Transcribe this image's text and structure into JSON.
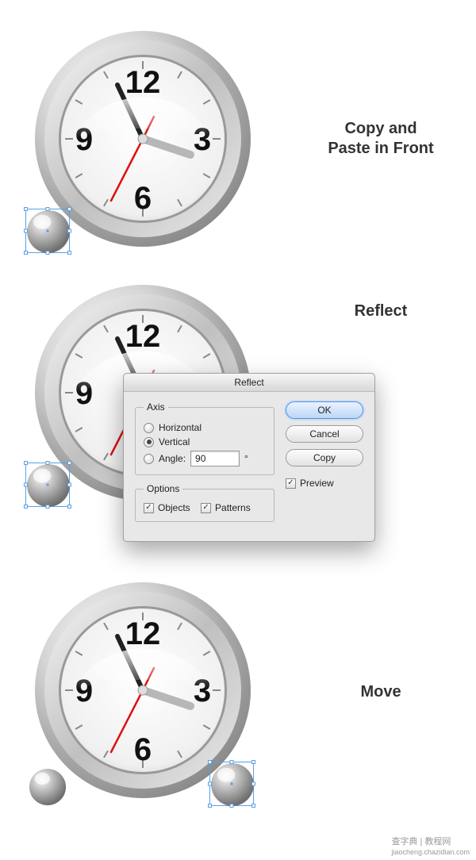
{
  "steps": {
    "copy_paste": "Copy and\nPaste in Front",
    "reflect": "Reflect",
    "move": "Move"
  },
  "dialog": {
    "title": "Reflect",
    "axis_legend": "Axis",
    "horizontal": "Horizontal",
    "vertical": "Vertical",
    "angle_label": "Angle:",
    "angle_value": "90",
    "degree": "°",
    "options_legend": "Options",
    "objects": "Objects",
    "patterns": "Patterns",
    "ok": "OK",
    "cancel": "Cancel",
    "copy": "Copy",
    "preview": "Preview"
  },
  "clock": {
    "numerals": {
      "n12": "12",
      "n3": "3",
      "n6": "6",
      "n9": "9"
    }
  },
  "watermark": {
    "brand": "查字典",
    "label": "教程网",
    "url": "jiaocheng.chazidian.com"
  }
}
